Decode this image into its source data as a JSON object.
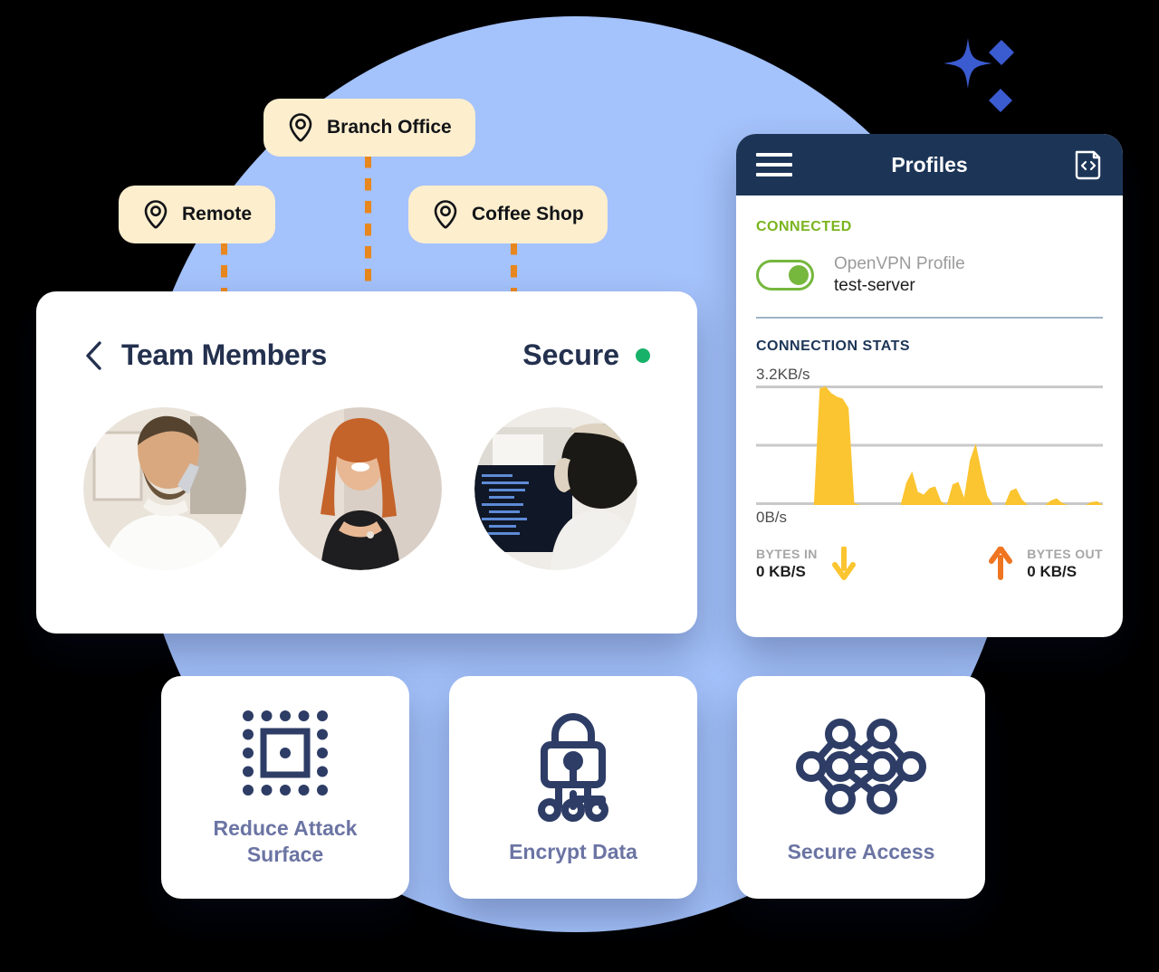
{
  "theme": {
    "circle_blue": "#a4c2fb",
    "pill_cream": "#fdeece",
    "dash_orange": "#e8871e",
    "navy": "#1c3557",
    "green": "#76b73d",
    "secure_green": "#18b169",
    "chart_yellow": "#fbc531",
    "bytes_out_orange": "#ef7521",
    "feature_label": "#6b74a3",
    "sparkle_blue": "#3b5bd0"
  },
  "decor": {
    "sparkle_name": "sparkle-decoration"
  },
  "locations": [
    {
      "id": "branch",
      "label": "Branch Office",
      "icon": "map-pin-icon"
    },
    {
      "id": "remote",
      "label": "Remote",
      "icon": "map-pin-icon"
    },
    {
      "id": "coffee",
      "label": "Coffee Shop",
      "icon": "map-pin-icon"
    }
  ],
  "team_card": {
    "back_icon": "chevron-left-icon",
    "title": "Team Members",
    "status_label": "Secure",
    "status_color": "#18b169",
    "avatars": [
      {
        "alt": "man-on-phone-avatar"
      },
      {
        "alt": "woman-smiling-avatar"
      },
      {
        "alt": "developer-with-headphones-avatar"
      }
    ]
  },
  "vpn_app": {
    "appbar": {
      "menu_icon": "hamburger-menu-icon",
      "title": "Profiles",
      "right_icon": "import-profile-icon"
    },
    "connected_label": "CONNECTED",
    "toggle_on": true,
    "profile_kind": "OpenVPN Profile",
    "profile_name": "test-server",
    "stats_label": "CONNECTION STATS",
    "axis_top": "3.2KB/s",
    "axis_bottom": "0B/s",
    "bytes_in": {
      "caption": "BYTES IN",
      "value": "0 KB/S",
      "icon": "arrow-down-icon"
    },
    "bytes_out": {
      "caption": "BYTES OUT",
      "value": "0 KB/S",
      "icon": "arrow-up-icon"
    }
  },
  "chart_data": {
    "type": "area",
    "title": "CONNECTION STATS",
    "ylabel": "",
    "xlabel": "",
    "ylim": [
      0,
      3.2
    ],
    "yticks": [
      0,
      3.2
    ],
    "ytick_labels": [
      "0B/s",
      "3.2KB/s"
    ],
    "grid": true,
    "gridlines": [
      0,
      1.6,
      3.2
    ],
    "unit": "KB/s",
    "legend": null,
    "series": [
      {
        "name": "throughput",
        "color": "#fbc531",
        "x": [
          0,
          1,
          2,
          3,
          4,
          5,
          6,
          7,
          8,
          9,
          10,
          11,
          12,
          13,
          14,
          15,
          16,
          17,
          18,
          19,
          20,
          21,
          22,
          23,
          24,
          25,
          26,
          27,
          28,
          29,
          30,
          31,
          32,
          33,
          34,
          35,
          36,
          37,
          38,
          39,
          40,
          41,
          42,
          43,
          44,
          45,
          46,
          47,
          48,
          49,
          50,
          51,
          52,
          53,
          54,
          55,
          56,
          57,
          58,
          59,
          60
        ],
        "values": [
          0,
          0,
          0,
          0,
          0,
          0,
          0,
          0,
          0,
          0,
          0,
          3.12,
          3.18,
          3.0,
          2.9,
          2.85,
          2.6,
          0.05,
          0,
          0,
          0,
          0,
          0,
          0,
          0,
          0,
          0.6,
          0.9,
          0.35,
          0.28,
          0.45,
          0.5,
          0.1,
          0,
          0.55,
          0.62,
          0.2,
          1.2,
          1.65,
          0.9,
          0.25,
          0,
          0,
          0,
          0.38,
          0.45,
          0.15,
          0,
          0,
          0,
          0,
          0.12,
          0.18,
          0.05,
          0,
          0,
          0,
          0,
          0.08,
          0.1,
          0
        ]
      }
    ]
  },
  "features": [
    {
      "id": "reduce-attack-surface",
      "label": "Reduce Attack\nSurface",
      "label_line1": "Reduce Attack",
      "label_line2": "Surface",
      "icon": "attack-surface-icon"
    },
    {
      "id": "encrypt-data",
      "label": "Encrypt Data",
      "label_line1": "Encrypt Data",
      "label_line2": "",
      "icon": "padlock-network-icon"
    },
    {
      "id": "secure-access",
      "label": "Secure Access",
      "label_line1": "Secure Access",
      "label_line2": "",
      "icon": "mesh-network-icon"
    }
  ]
}
